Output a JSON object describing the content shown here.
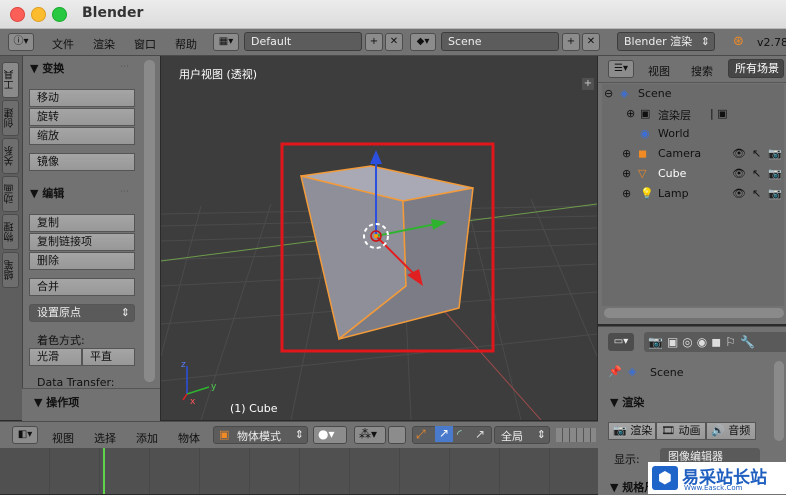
{
  "window": {
    "title": "Blender"
  },
  "topbar": {
    "menus": [
      "文件",
      "渲染",
      "窗口",
      "帮助"
    ],
    "layout_value": "Default",
    "scene_value": "Scene",
    "engine_value": "Blender 渲染",
    "version": "v2.78"
  },
  "toolshelf": {
    "tabs": [
      "工具",
      "创建",
      "关系",
      "动画",
      "物理",
      "蜡笔"
    ],
    "transform_title": "▼ 变换",
    "transform_buttons": [
      "移动",
      "旋转",
      "缩放"
    ],
    "mirror_button": "镜像",
    "edit_title": "▼ 编辑",
    "edit_buttons": [
      "复制",
      "复制链接项",
      "删除"
    ],
    "join_button": "合并",
    "set_origin_label": "设置原点",
    "shading_label": "着色方式:",
    "smooth_button": "光滑",
    "flat_button": "平直",
    "data_transfer_label": "Data Transfer:",
    "operator_title": "▼ 操作项"
  },
  "viewport": {
    "view_label": "用户视图 (透视)",
    "object_label": "(1) Cube",
    "highlight_color": "#e0161b"
  },
  "outliner": {
    "view_label": "视图",
    "search_label": "搜索",
    "filter_label": "所有场景",
    "items": [
      "Scene",
      "渲染层",
      "World",
      "Camera",
      "Cube",
      "Lamp"
    ]
  },
  "properties": {
    "scene_label": "Scene",
    "render_section": "▼ 渲染",
    "render_btn": "渲染",
    "anim_btn": "动画",
    "audio_btn": "音频",
    "display_label": "显示:",
    "display_value": "图像编辑器",
    "dims_section": "▼ 规格尺"
  },
  "viewport_header": {
    "menus": [
      "视图",
      "选择",
      "添加",
      "物体"
    ],
    "mode_value": "物体模式",
    "global_value": "全局"
  },
  "watermark": {
    "text": "易采站长站",
    "subtext": "Www.Easck.Com"
  }
}
